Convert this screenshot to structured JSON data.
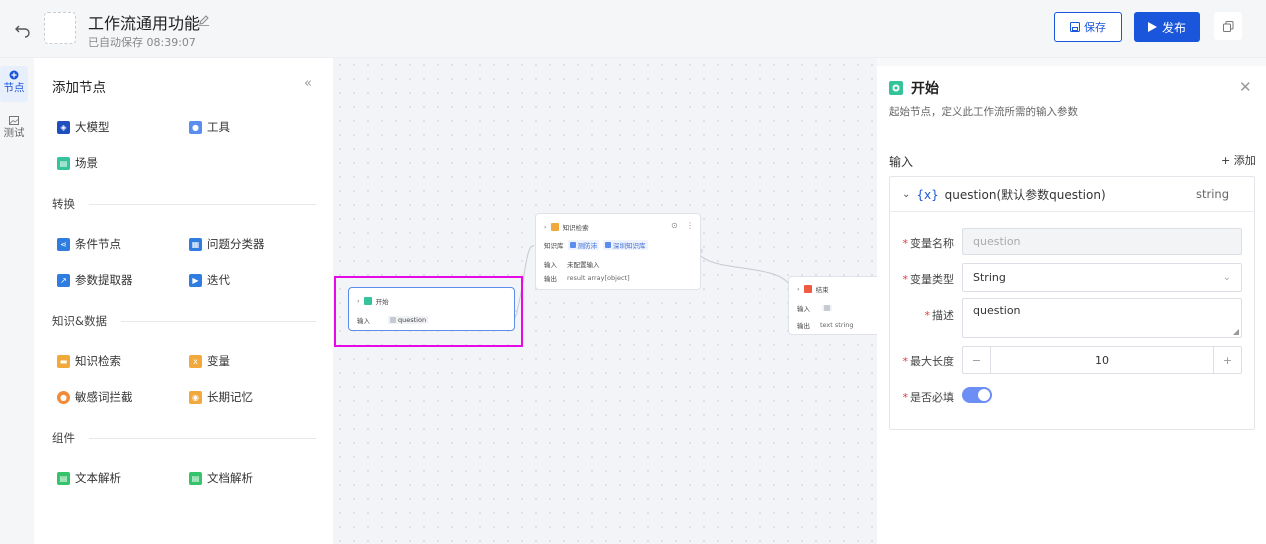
{
  "header": {
    "title": "工作流通用功能",
    "autosave": "已自动保存 08:39:07",
    "save_label": "保存",
    "publish_label": "发布"
  },
  "rail": [
    {
      "label": "节点",
      "icon": "plus-circle-icon",
      "active": true
    },
    {
      "label": "测试",
      "icon": "image-icon",
      "active": false
    }
  ],
  "panel": {
    "title": "添加节点",
    "collapse_icon": "«",
    "groups": [
      {
        "title": "",
        "items": [
          {
            "label": "大模型",
            "color": "#1f4fbf",
            "icon": "model-icon"
          },
          {
            "label": "工具",
            "color": "#5b8def",
            "icon": "tool-icon"
          },
          {
            "label": "场景",
            "color": "#35c39b",
            "icon": "scene-icon"
          }
        ]
      },
      {
        "title": "转换",
        "items": [
          {
            "label": "条件节点",
            "color": "#2f7de1",
            "icon": "branch-icon"
          },
          {
            "label": "问题分类器",
            "color": "#2f7de1",
            "icon": "classifier-icon"
          },
          {
            "label": "参数提取器",
            "color": "#2f7de1",
            "icon": "extractor-icon"
          },
          {
            "label": "迭代",
            "color": "#2f7de1",
            "icon": "iterate-icon"
          }
        ]
      },
      {
        "title": "知识&数据",
        "items": [
          {
            "label": "知识检索",
            "color": "#f2a93b",
            "icon": "knowledge-icon"
          },
          {
            "label": "变量",
            "color": "#f2a93b",
            "icon": "variable-icon"
          },
          {
            "label": "敏感词拦截",
            "color": "#f28a3b",
            "icon": "shield-icon"
          },
          {
            "label": "长期记忆",
            "color": "#f2a93b",
            "icon": "memory-icon"
          }
        ]
      },
      {
        "title": "组件",
        "items": [
          {
            "label": "文本解析",
            "color": "#35c36b",
            "icon": "text-parse-icon"
          },
          {
            "label": "文档解析",
            "color": "#35c36b",
            "icon": "doc-parse-icon"
          }
        ]
      }
    ]
  },
  "canvas": {
    "start_node": {
      "title": "开始",
      "input_label": "输入",
      "input_value": "question"
    },
    "knowledge_node": {
      "title": "知识检索",
      "kb_label": "知识库",
      "kb_items": [
        "测防沛",
        "深圳知识库"
      ],
      "input_label": "输入",
      "input_value": "未配置输入",
      "output_label": "输出",
      "output_value": "result  array[object]"
    },
    "end_node": {
      "title": "结束",
      "input_label": "输入",
      "input_value": "",
      "output_label": "输出",
      "output_value": "text  string"
    }
  },
  "right_panel": {
    "title": "开始",
    "description": "起始节点，定义此工作流所需的输入参数",
    "input_label": "输入",
    "add_label": "+ 添加",
    "variable": {
      "brace": "{x}",
      "name": "question(默认参数question)",
      "type": "string",
      "fields": {
        "name_label": "变量名称",
        "name_value": "question",
        "type_label": "变量类型",
        "type_value": "String",
        "desc_label": "描述",
        "desc_value": "question",
        "maxlen_label": "最大长度",
        "maxlen_value": "10",
        "required_label": "是否必填",
        "required": true
      }
    }
  }
}
